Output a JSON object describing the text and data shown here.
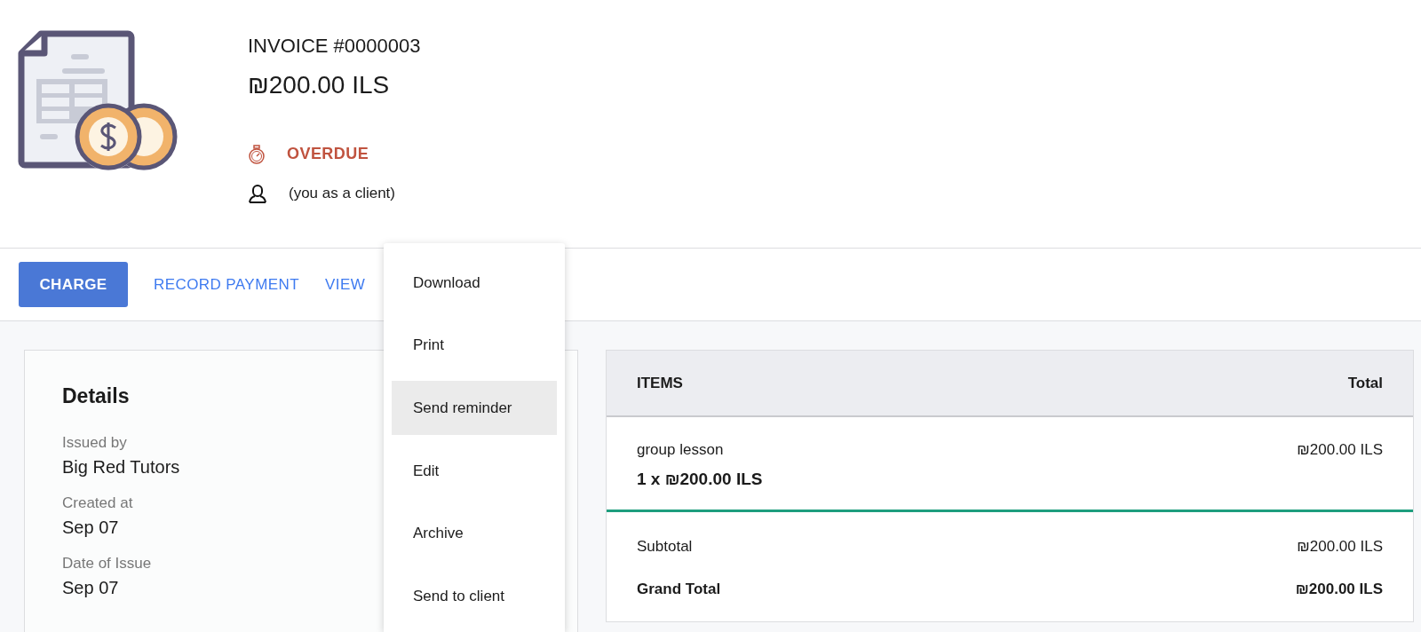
{
  "invoice": {
    "title": "INVOICE #0000003",
    "amount": "₪200.00 ILS",
    "status": {
      "kind": "overdue",
      "label": "OVERDUE"
    },
    "client": "(you as a client)"
  },
  "actions": [
    {
      "kind": "primary",
      "label": "CHARGE"
    },
    {
      "kind": "link",
      "label": "RECORD PAYMENT"
    },
    {
      "kind": "link",
      "label": "VIEW"
    }
  ],
  "menu": [
    {
      "label": "Download",
      "selected": false
    },
    {
      "label": "Print",
      "selected": false
    },
    {
      "label": "Send reminder",
      "selected": true
    },
    {
      "label": "Edit",
      "selected": false
    },
    {
      "label": "Archive",
      "selected": false
    },
    {
      "label": "Send to client",
      "selected": false
    }
  ],
  "details": {
    "title": "Details",
    "fields": [
      {
        "label": "Issued by",
        "value": "Big Red Tutors"
      },
      {
        "label": "Created at",
        "value": "Sep 07"
      },
      {
        "label": "Date of Issue",
        "value": "Sep 07"
      }
    ]
  },
  "items_table": {
    "columns": [
      "ITEMS",
      "Total"
    ],
    "rows": [
      {
        "name": "group lesson",
        "quantity": "1 x ₪200.00 ILS",
        "total": "₪200.00 ILS"
      }
    ],
    "subtotal": {
      "label": "Subtotal",
      "value": "₪200.00 ILS"
    },
    "grand_total": {
      "label": "Grand Total",
      "value": "₪200.00 ILS"
    }
  }
}
